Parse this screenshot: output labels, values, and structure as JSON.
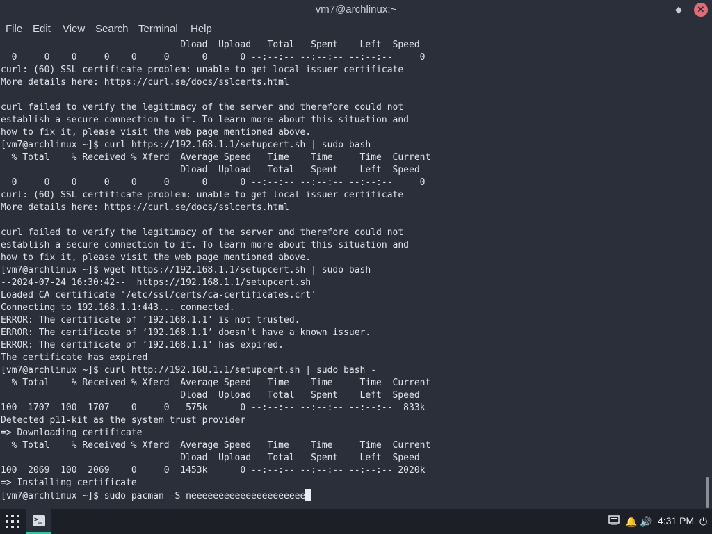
{
  "window": {
    "title": "vm7@archlinux:~"
  },
  "icons": {
    "minimize": "minimize-icon",
    "maximize": "maximize-icon",
    "close": "close-icon",
    "apps": "app-grid-icon",
    "terminal": "terminal-icon",
    "network": "network-icon",
    "notifications": "bell-icon",
    "volume": "volume-icon",
    "power": "power-icon"
  },
  "menu": [
    "File",
    "Edit",
    "View",
    "Search",
    "Terminal",
    "Help"
  ],
  "terminal": {
    "lines": [
      "                                 Dload  Upload   Total   Spent    Left  Speed",
      "  0     0    0     0    0     0      0      0 --:--:-- --:--:-- --:--:--     0",
      "curl: (60) SSL certificate problem: unable to get local issuer certificate",
      "More details here: https://curl.se/docs/sslcerts.html",
      "",
      "curl failed to verify the legitimacy of the server and therefore could not",
      "establish a secure connection to it. To learn more about this situation and",
      "how to fix it, please visit the web page mentioned above.",
      "[vm7@archlinux ~]$ curl https://192.168.1.1/setupcert.sh | sudo bash",
      "  % Total    % Received % Xferd  Average Speed   Time    Time     Time  Current",
      "                                 Dload  Upload   Total   Spent    Left  Speed",
      "  0     0    0     0    0     0      0      0 --:--:-- --:--:-- --:--:--     0",
      "curl: (60) SSL certificate problem: unable to get local issuer certificate",
      "More details here: https://curl.se/docs/sslcerts.html",
      "",
      "curl failed to verify the legitimacy of the server and therefore could not",
      "establish a secure connection to it. To learn more about this situation and",
      "how to fix it, please visit the web page mentioned above.",
      "[vm7@archlinux ~]$ wget https://192.168.1.1/setupcert.sh | sudo bash",
      "--2024-07-24 16:30:42--  https://192.168.1.1/setupcert.sh",
      "Loaded CA certificate '/etc/ssl/certs/ca-certificates.crt'",
      "Connecting to 192.168.1.1:443... connected.",
      "ERROR: The certificate of ‘192.168.1.1’ is not trusted.",
      "ERROR: The certificate of ‘192.168.1.1’ doesn't have a known issuer.",
      "ERROR: The certificate of ‘192.168.1.1’ has expired.",
      "The certificate has expired",
      "[vm7@archlinux ~]$ curl http://192.168.1.1/setupcert.sh | sudo bash -",
      "  % Total    % Received % Xferd  Average Speed   Time    Time     Time  Current",
      "                                 Dload  Upload   Total   Spent    Left  Speed",
      "100  1707  100  1707    0     0   575k      0 --:--:-- --:--:-- --:--:--  833k",
      "Detected p11-kit as the system trust provider",
      "=> Downloading certificate",
      "  % Total    % Received % Xferd  Average Speed   Time    Time     Time  Current",
      "                                 Dload  Upload   Total   Spent    Left  Speed",
      "100  2069  100  2069    0     0  1453k      0 --:--:-- --:--:-- --:--:-- 2020k",
      "=> Installing certificate"
    ],
    "prompt": "[vm7@archlinux ~]$ sudo pacman -S neeeeeeeeeeeeeeeeeeeee"
  },
  "taskbar": {
    "clock": "4:31 PM"
  }
}
